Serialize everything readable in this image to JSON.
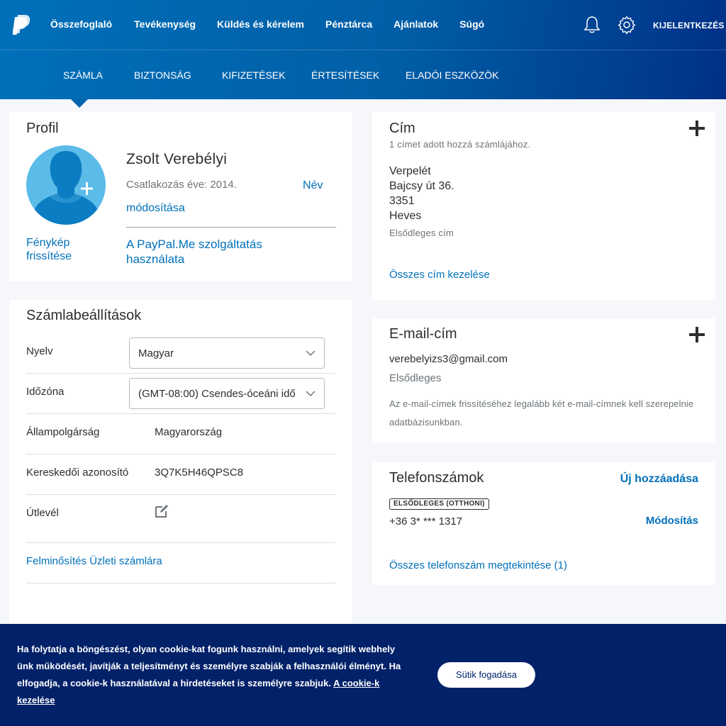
{
  "header": {
    "nav": [
      "Összefoglaló",
      "Tevékenység",
      "Küldés és kérelem",
      "Pénztárca",
      "Ajánlatok",
      "Súgó"
    ],
    "logout": "KIJELENTKEZÉS",
    "subnav": [
      "SZÁMLA",
      "BIZTONSÁG",
      "KIFIZETÉSEK",
      "ÉRTESÍTÉSEK",
      "ELADÓI ESZKÖZÖK"
    ]
  },
  "profile": {
    "title": "Profil",
    "name": "Zsolt Verebélyi",
    "joined": "Csatlakozás éve: 2014.",
    "edit_name_1": "Név",
    "edit_name_2": "módosítása",
    "photo_1": "Fénykép",
    "photo_2": "frissítése",
    "paypalme_1": "A PayPal.Me szolgáltatás",
    "paypalme_2": "használata"
  },
  "settings": {
    "title": "Számlabeállítások",
    "language_label": "Nyelv",
    "language_value": "Magyar",
    "timezone_label": "Időzóna",
    "timezone_value": "(GMT-08:00) Csendes-óceáni idő",
    "citizenship_label": "Állampolgárság",
    "citizenship_value": "Magyarország",
    "merchant_label": "Kereskedői azonosító",
    "merchant_value": "3Q7K5H46QPSC8",
    "passport_label": "Útlevél",
    "upgrade": "Felminősítés Üzleti számlára"
  },
  "address": {
    "title": "Cím",
    "subtitle": "1 címet adott hozzá számlájához.",
    "lines": [
      "Verpelét",
      "Bajcsy út 36.",
      "3351",
      "Heves"
    ],
    "primary": "Elsődleges cím",
    "manage": "Összes cím kezelése"
  },
  "email": {
    "title": "E-mail-cím",
    "address": "verebelyizs3@gmail.com",
    "primary": "Elsődleges",
    "note_1": "Az e-mail-címek frissítéséhez legalább két e-mail-címnek kell szerepelnie",
    "note_2": "adatbázisunkban."
  },
  "phone": {
    "title": "Telefonszámok",
    "add": "Új hozzáadása",
    "badge": "ELSŐDLEGES (OTTHONI)",
    "number": "+36 3* *** 1317",
    "edit": "Módosítás",
    "view_all": "Összes telefonszám megtekintése (1)"
  },
  "cookie": {
    "text": "Ha folytatja a böngészést, olyan cookie-kat fogunk használni, amelyek segítik webhely ünk működését, javítják a teljesítményt és személyre szabják a felhasználói élményt. Ha elfogadja, a cookie-k használatával a hirdetéseket is személyre szabjuk.",
    "link": "A cookie-k kezelése",
    "accept": "Sütik fogadása"
  },
  "colors": {
    "brand": "#0070ba",
    "header_dark": "#003087",
    "cookie_bg": "#012169"
  }
}
